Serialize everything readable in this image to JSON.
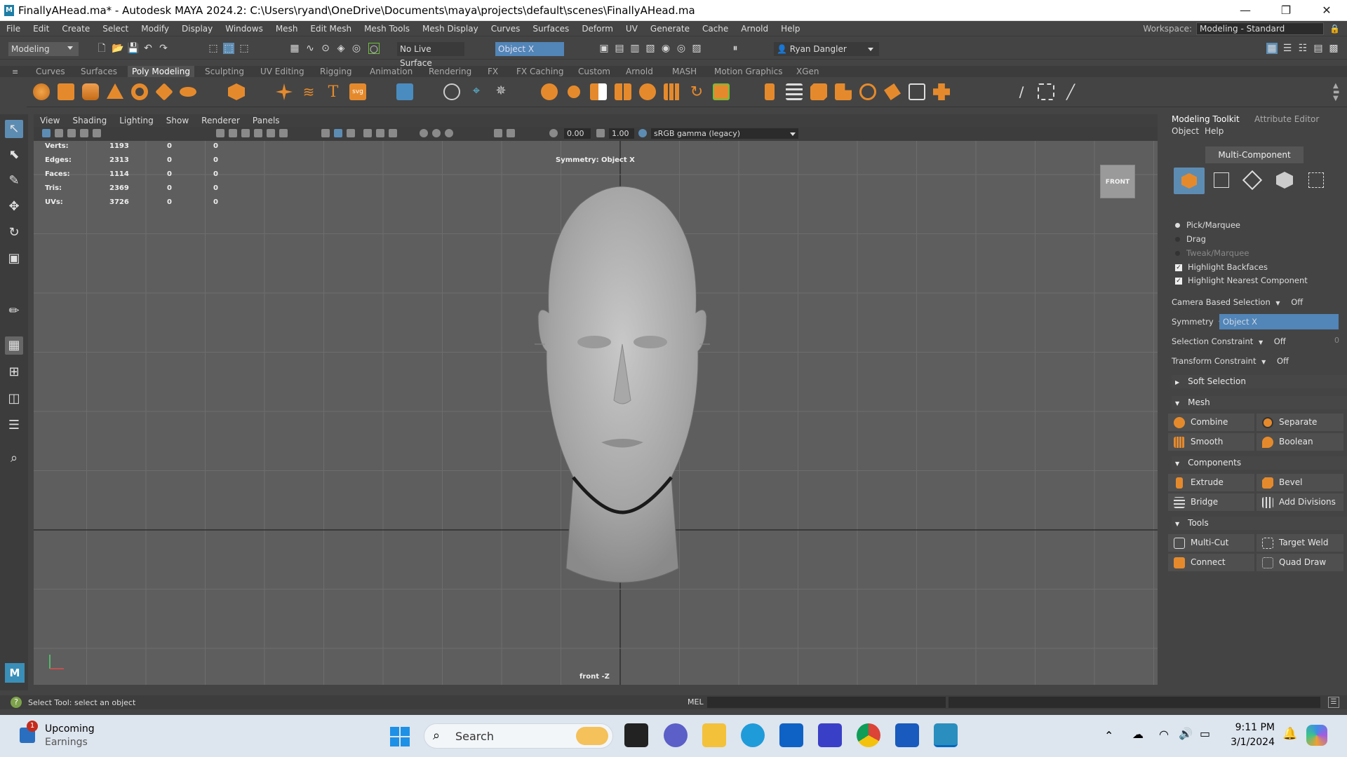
{
  "window": {
    "title": "FinallyAHead.ma* - Autodesk MAYA 2024.2: C:\\Users\\ryand\\OneDrive\\Documents\\maya\\projects\\default\\scenes\\FinallyAHead.ma",
    "controls": [
      "minimize",
      "restore",
      "close"
    ]
  },
  "menubar": {
    "items": [
      "File",
      "Edit",
      "Create",
      "Select",
      "Modify",
      "Display",
      "Windows",
      "Mesh",
      "Edit Mesh",
      "Mesh Tools",
      "Mesh Display",
      "Curves",
      "Surfaces",
      "Deform",
      "UV",
      "Generate",
      "Cache",
      "Arnold",
      "Help"
    ],
    "workspace_label": "Workspace:",
    "workspace_value": "Modeling - Standard"
  },
  "statusline": {
    "mode": "Modeling",
    "live_surface": "No Live Surface",
    "symmetry_field": "Object X",
    "user": "Ryan Dangler"
  },
  "shelf": {
    "tabs": [
      "Curves",
      "Surfaces",
      "Poly Modeling",
      "Sculpting",
      "UV Editing",
      "Rigging",
      "Animation",
      "Rendering",
      "FX",
      "FX Caching",
      "Custom",
      "Arnold",
      "MASH",
      "Motion Graphics",
      "XGen"
    ],
    "active_tab": "Poly Modeling"
  },
  "viewport": {
    "menus": [
      "View",
      "Shading",
      "Lighting",
      "Show",
      "Renderer",
      "Panels"
    ],
    "exposure": "0.00",
    "gamma": "1.00",
    "color_space": "sRGB gamma (legacy)",
    "symmetry_label": "Symmetry: Object X",
    "camera_label": "front -Z",
    "viewcube_label": "FRONT",
    "stats": [
      {
        "label": "Verts:",
        "total": "1193",
        "sel": "0",
        "comp": "0"
      },
      {
        "label": "Edges:",
        "total": "2313",
        "sel": "0",
        "comp": "0"
      },
      {
        "label": "Faces:",
        "total": "1114",
        "sel": "0",
        "comp": "0"
      },
      {
        "label": "Tris:",
        "total": "2369",
        "sel": "0",
        "comp": "0"
      },
      {
        "label": "UVs:",
        "total": "3726",
        "sel": "0",
        "comp": "0"
      }
    ]
  },
  "toolkit": {
    "tabs": [
      "Modeling Toolkit",
      "Attribute Editor"
    ],
    "submenu": [
      "Object",
      "Help"
    ],
    "multi_component": "Multi-Component",
    "options": {
      "pick_marquee": "Pick/Marquee",
      "drag": "Drag",
      "tweak_marquee": "Tweak/Marquee",
      "highlight_backfaces": "Highlight Backfaces",
      "highlight_nearest": "Highlight Nearest Component"
    },
    "camera_based_selection": {
      "label": "Camera Based Selection",
      "value": "Off"
    },
    "symmetry": {
      "label": "Symmetry",
      "value": "Object X"
    },
    "selection_constraint": {
      "label": "Selection Constraint",
      "value": "Off",
      "number": "0"
    },
    "transform_constraint": {
      "label": "Transform Constraint",
      "value": "Off"
    },
    "soft_selection": "Soft Selection",
    "mesh": {
      "title": "Mesh",
      "buttons": [
        "Combine",
        "Separate",
        "Smooth",
        "Boolean"
      ]
    },
    "components": {
      "title": "Components",
      "buttons": [
        "Extrude",
        "Bevel",
        "Bridge",
        "Add Divisions"
      ]
    },
    "tools": {
      "title": "Tools",
      "buttons": [
        "Multi-Cut",
        "Target Weld",
        "Connect",
        "Quad Draw"
      ]
    }
  },
  "commandline": {
    "status": "Select Tool: select an object",
    "lang": "MEL"
  },
  "taskbar": {
    "widget_badge": "1",
    "widget_title": "Upcoming",
    "widget_sub": "Earnings",
    "search": "Search",
    "time": "9:11 PM",
    "date": "3/1/2024"
  },
  "colors": {
    "accent": "#5d8cb3",
    "ui_bg": "#444444",
    "viewport_bg": "#5e5e5e",
    "symmetry_field_bg": "#5285b8",
    "shelf_orange": "#e58a2c"
  }
}
